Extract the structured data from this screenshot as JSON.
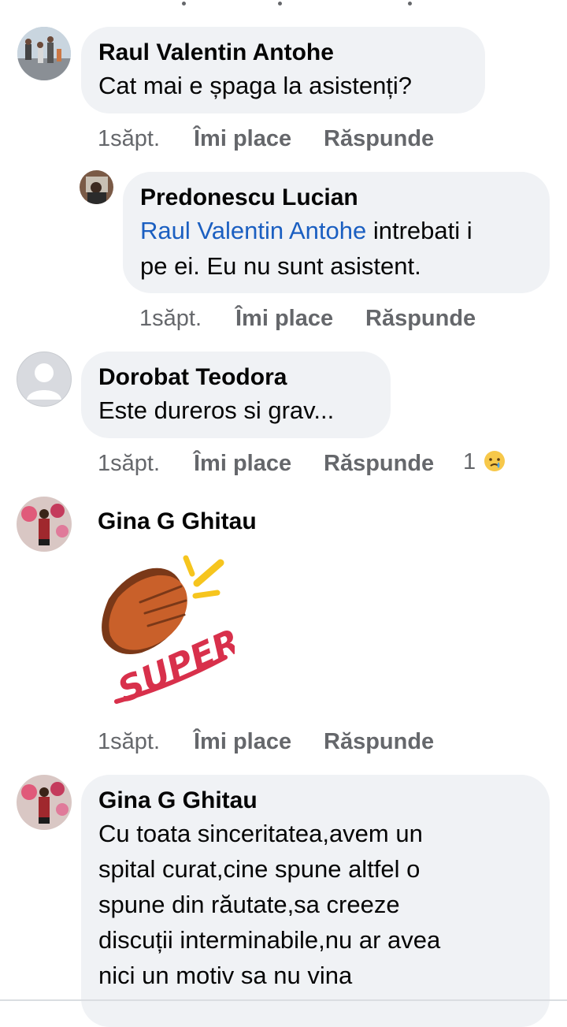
{
  "comments": [
    {
      "author": "Raul Valentin Antohe",
      "text": "Cat mai e șpaga la asistenți?",
      "time": "1săpt.",
      "like": "Îmi place",
      "reply": "Răspunde"
    },
    {
      "author": "Predonescu Lucian",
      "mention": "Raul Valentin Antohe",
      "text_line1": " intrebati i",
      "text_line2": "pe ei. Eu nu sunt asistent.",
      "time": "1săpt.",
      "like": "Îmi place",
      "reply": "Răspunde"
    },
    {
      "author": "Dorobat Teodora",
      "text": "Este dureros si grav...",
      "time": "1săpt.",
      "like": "Îmi place",
      "reply": "Răspunde",
      "reaction_count": "1",
      "reaction_icon": "sad-crying-emoji-icon"
    },
    {
      "author": "Gina G Ghitau",
      "sticker_text": "SUPER!",
      "time": "1săpt.",
      "like": "Îmi place",
      "reply": "Răspunde"
    },
    {
      "author": "Gina G Ghitau",
      "lines": [
        "Cu toata sinceritatea,avem un",
        "spital curat,cine spune altfel o",
        "spune din răutate,sa creeze",
        "discuții interminabile,nu ar avea",
        "nici un motiv sa nu vina"
      ]
    }
  ],
  "colors": {
    "bubble": "#f0f2f5",
    "mention": "#1b5fc1",
    "meta": "#65676b"
  }
}
